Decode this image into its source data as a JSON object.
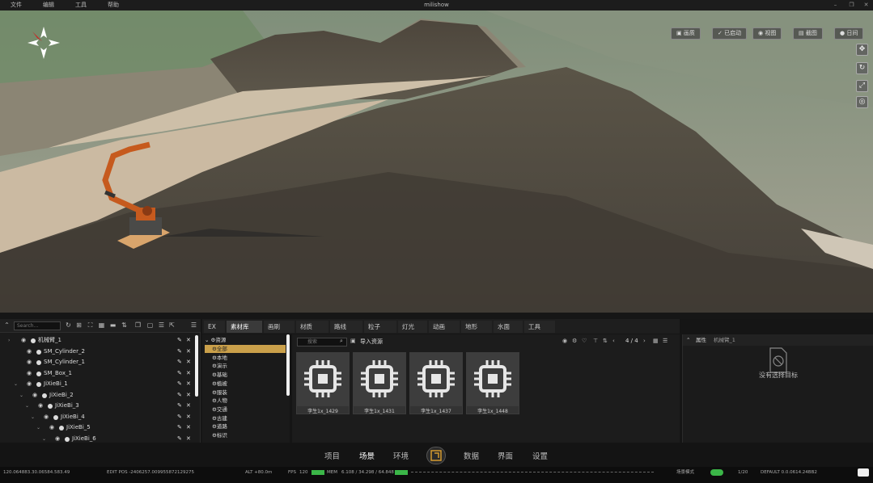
{
  "window": {
    "title": "milishow",
    "menu": [
      "文件",
      "编辑",
      "工具",
      "帮助"
    ]
  },
  "viewport": {
    "top_buttons": [
      "画质",
      "已启动",
      "视图",
      "截图",
      "日间"
    ],
    "side_icons": [
      "move-icon",
      "rotate-icon",
      "zoom-icon",
      "camera-icon"
    ]
  },
  "outliner": {
    "search_placeholder": "Search...",
    "rows": [
      {
        "label": "机械臂_1",
        "indent": 0,
        "expand": "right"
      },
      {
        "label": "SM_Cylinder_2",
        "indent": 1,
        "expand": ""
      },
      {
        "label": "SM_Cylinder_1",
        "indent": 1,
        "expand": ""
      },
      {
        "label": "SM_Box_1",
        "indent": 1,
        "expand": ""
      },
      {
        "label": "JiXieBi_1",
        "indent": 1,
        "expand": "down"
      },
      {
        "label": "JiXieBi_2",
        "indent": 2,
        "expand": "down"
      },
      {
        "label": "JiXieBi_3",
        "indent": 3,
        "expand": "down"
      },
      {
        "label": "JiXieBi_4",
        "indent": 4,
        "expand": "down"
      },
      {
        "label": "JiXieBi_5",
        "indent": 5,
        "expand": "down"
      },
      {
        "label": "JiXieBi_6",
        "indent": 6,
        "expand": "down"
      }
    ]
  },
  "tabs": [
    "EX",
    "素材库",
    "画刷",
    "材质",
    "路线",
    "粒子",
    "灯光",
    "动画",
    "地形",
    "水面",
    "工具"
  ],
  "active_tab": 1,
  "resource_tree": {
    "root": "资源",
    "items": [
      "全部",
      "本地",
      "演示",
      "基础",
      "植被",
      "服装",
      "人物",
      "交通",
      "古建",
      "道路",
      "标识"
    ],
    "selected": 0
  },
  "resource_main": {
    "search_placeholder": "搜索",
    "import_label": "导入资源",
    "page": "4 / 4",
    "tiles": [
      "李生1x_1429",
      "李生1x_1431",
      "李生1x_1437",
      "李生1x_1448"
    ]
  },
  "properties": {
    "header": "属性",
    "sub": "机械臂_1",
    "empty_text": "没有选择目标"
  },
  "bottom_nav": {
    "items": [
      "项目",
      "场景",
      "环境",
      "数据",
      "界面",
      "设置"
    ],
    "active": 1
  },
  "statusbar": {
    "fps_label": "FPS",
    "fps_value": "120",
    "mem_label": "MEM",
    "mem_value": "6.108 / 34.298 / 64.848",
    "coords": "120.064883.30.06584.583.49",
    "edit": "EDIT POS -2406257.009955872129275",
    "alt": "ALT +80.0m",
    "scene_mode": "场景模式",
    "frame": "1/20",
    "version": "DEFAULT 0.0.0614.24BB2"
  },
  "colors": {
    "accent": "#d49a2f",
    "selected_item": "#caa04a",
    "meter_green": "#3bb648"
  }
}
